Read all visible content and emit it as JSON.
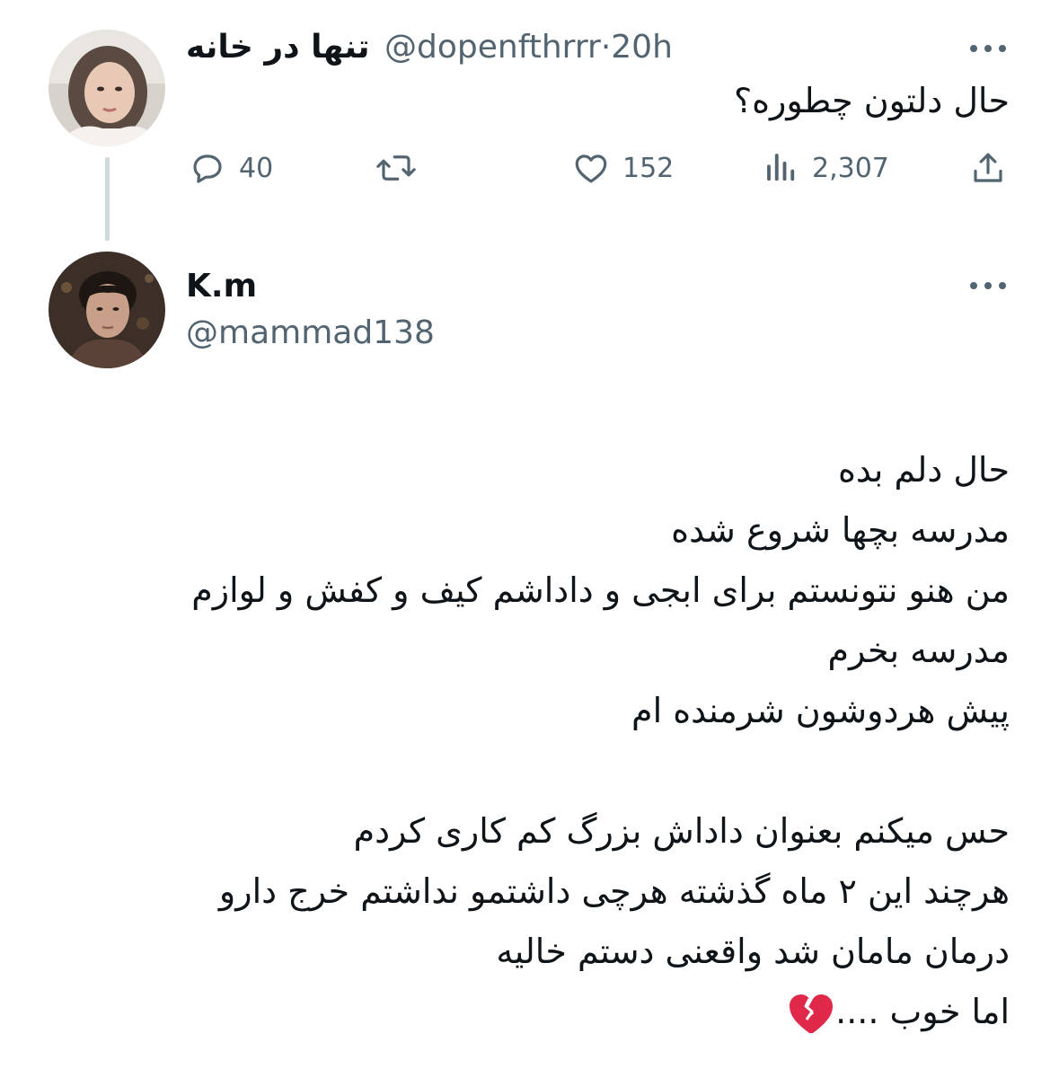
{
  "tweet1": {
    "display_name": "تنها در خانه",
    "handle": "@dopenfthrrr",
    "separator": "·",
    "time": "20h",
    "text": "حال دلتون چطوره؟",
    "actions": {
      "replies": "40",
      "likes": "152",
      "views": "2,307"
    }
  },
  "tweet2": {
    "display_name": "K.m",
    "handle": "@mammad138",
    "lines": [
      "حال دلم بده",
      "مدرسه بچها شروع شده",
      "من هنو نتونستم برای ابجی و داداشم کیف و کفش و لوازم",
      "مدرسه بخرم",
      "پیش هردوشون شرمنده ام",
      "",
      "حس میکنم بعنوان داداش بزرگ کم کاری کردم",
      "هرچند این ۲ ماه گذشته هرچی داشتمو نداشتم خرج دارو",
      "درمان مامان شد واقعنی دستم خالیه",
      "اما خوب ...."
    ],
    "last_line_emoji": "broken-heart-emoji"
  },
  "icons": {
    "reply": "reply-icon",
    "retweet": "retweet-icon",
    "like": "heart-icon",
    "views": "views-icon",
    "share": "share-icon",
    "more": "more-icon"
  },
  "colors": {
    "text": "#0f1419",
    "secondary": "#536471",
    "thread_line": "#cfd9de",
    "broken_heart": "#e0294a"
  }
}
